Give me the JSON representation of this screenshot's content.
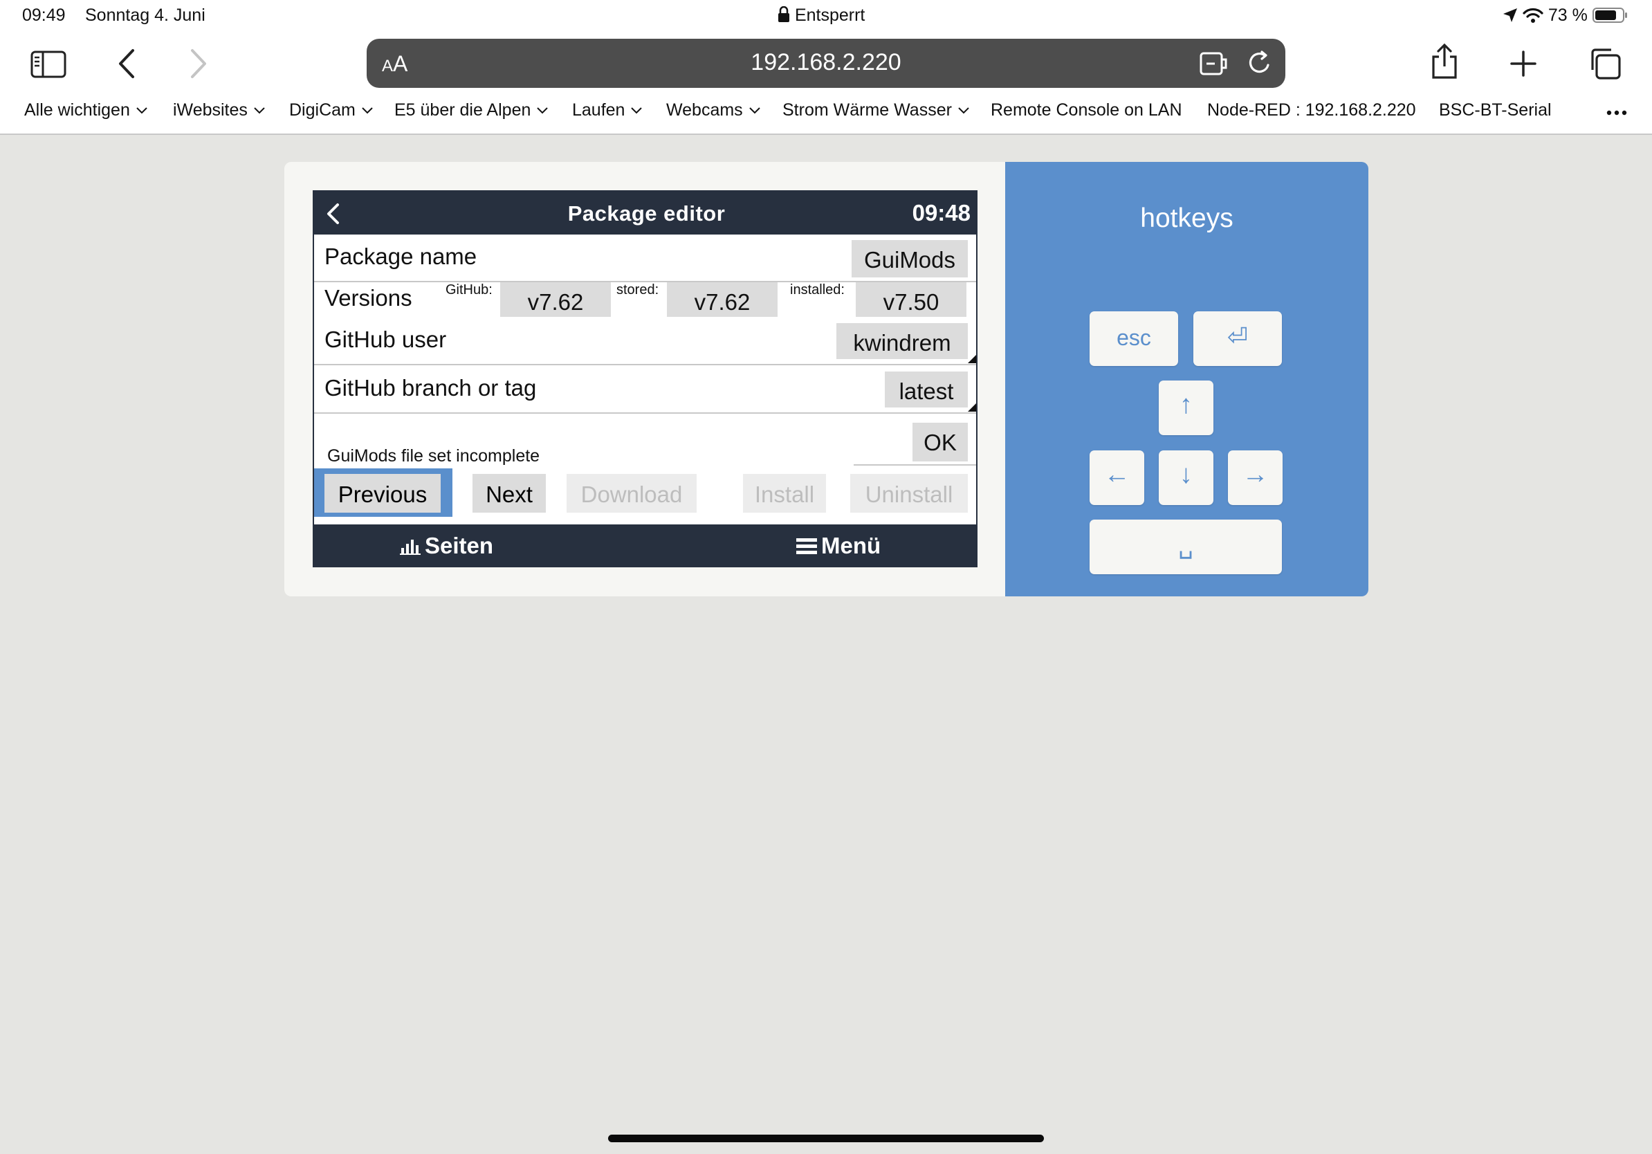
{
  "status_bar": {
    "time": "09:49",
    "date": "Sonntag 4. Juni",
    "lock_text": "Entsperrt",
    "battery": "73 %"
  },
  "toolbar": {
    "aa_label": "A",
    "aa_label_big": "A",
    "url": "192.168.2.220"
  },
  "bookmarks": [
    {
      "label": "Alle wichtigen",
      "folder": true
    },
    {
      "label": "iWebsites",
      "folder": true
    },
    {
      "label": "DigiCam",
      "folder": true
    },
    {
      "label": "E5 über die Alpen",
      "folder": true
    },
    {
      "label": "Laufen",
      "folder": true
    },
    {
      "label": "Webcams",
      "folder": true
    },
    {
      "label": "Strom Wärme Wasser",
      "folder": true
    },
    {
      "label": "Remote Console on LAN",
      "folder": false
    },
    {
      "label": "Node-RED : 192.168.2.220",
      "folder": false
    },
    {
      "label": "BSC-BT-Serial",
      "folder": false
    }
  ],
  "console": {
    "title": "Package editor",
    "time": "09:48",
    "package_name_label": "Package name",
    "package_name_value": "GuiMods",
    "versions_label": "Versions",
    "github_label": "GitHub:",
    "github_version": "v7.62",
    "stored_label": "stored:",
    "stored_version": "v7.62",
    "installed_label": "installed:",
    "installed_version": "v7.50",
    "github_user_label": "GitHub user",
    "github_user_value": "kwindrem",
    "branch_label": "GitHub branch or tag",
    "branch_value": "latest",
    "ok_label": "OK",
    "status_message": "GuiMods file set incomplete",
    "buttons": {
      "previous": "Previous",
      "next": "Next",
      "download": "Download",
      "install": "Install",
      "uninstall": "Uninstall"
    },
    "footer": {
      "pages": "Seiten",
      "menu": "Menü"
    }
  },
  "hotkeys": {
    "title": "hotkeys",
    "esc": "esc",
    "enter_symbol": "⏎",
    "up_symbol": "↑",
    "left_symbol": "←",
    "down_symbol": "↓",
    "right_symbol": "→",
    "space_symbol": "␣"
  }
}
